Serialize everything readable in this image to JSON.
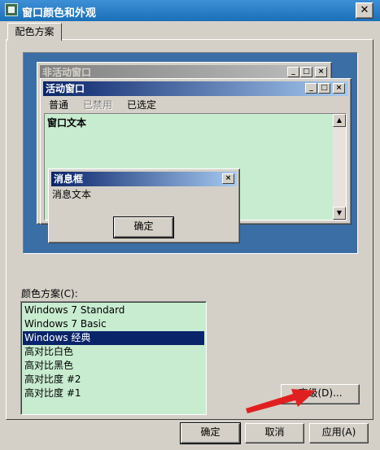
{
  "window": {
    "title": "窗口颜色和外观",
    "close_glyph": "✕"
  },
  "tabs": [
    {
      "label": "配色方案"
    }
  ],
  "preview": {
    "inactive_window_title": "非活动窗口",
    "active_window_title": "活动窗口",
    "menu": {
      "normal": "普通",
      "disabled": "已禁用",
      "selected": "已选定"
    },
    "window_text": "窗口文本",
    "message_box": {
      "title": "消息框",
      "text": "消息文本",
      "ok_label": "确定"
    },
    "caption_buttons": {
      "minimize": "_",
      "maximize": "□",
      "close": "×"
    },
    "scroll_up": "▲",
    "scroll_down": "▼"
  },
  "color_scheme": {
    "label": "颜色方案(C):",
    "items": [
      "Windows 7 Standard",
      "Windows 7 Basic",
      "Windows 经典",
      "高对比白色",
      "高对比黑色",
      "高对比度 #2",
      "高对比度 #1"
    ],
    "selected_index": 2
  },
  "buttons": {
    "advanced": "高级(D)...",
    "ok": "确定",
    "cancel": "取消",
    "apply": "应用(A)"
  },
  "colors": {
    "dialog_bg": "#d4d0c8",
    "desktop": "#3a6ea5",
    "active_title_start": "#0a246a",
    "active_title_end": "#a6caf0",
    "inactive_title_start": "#808080",
    "inactive_title_end": "#c0c0c0",
    "window_bg": "#c8ecd0",
    "selection": "#0a246a",
    "annotation_arrow": "#e02020"
  }
}
